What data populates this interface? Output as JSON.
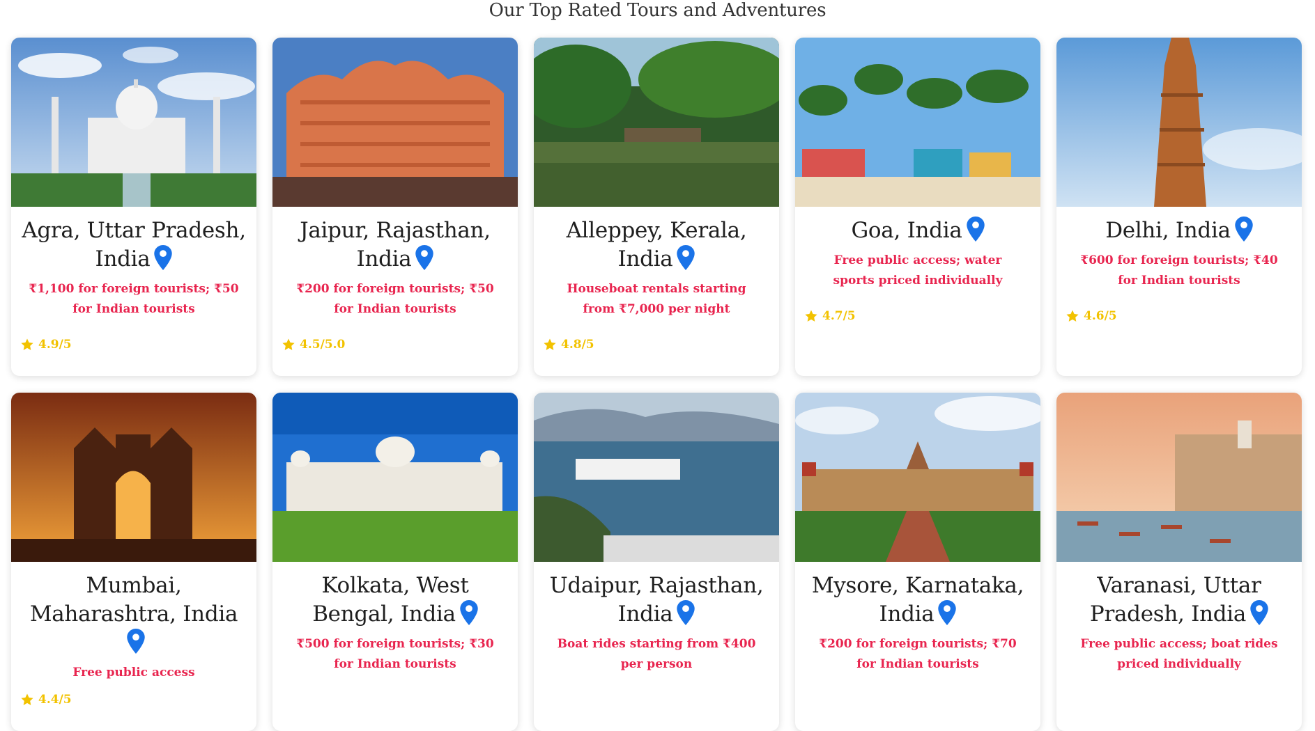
{
  "heading": "Our Top Rated Tours and Adventures",
  "icons": {
    "location": "map-pin-icon",
    "rating": "star-icon"
  },
  "colors": {
    "price": "#e8254f",
    "rating": "#f2c200",
    "pin": "#1a73e8"
  },
  "tours": [
    {
      "title": "Agra, Uttar Pradesh, India",
      "price": "₹1,100 for foreign tourists; ₹50 for Indian tourists",
      "rating": "4.9/5"
    },
    {
      "title": "Jaipur, Rajasthan, India",
      "price": "₹200 for foreign tourists; ₹50 for Indian tourists",
      "rating": "4.5/5.0"
    },
    {
      "title": "Alleppey, Kerala, India",
      "price": "Houseboat rentals starting from ₹7,000 per night",
      "rating": "4.8/5"
    },
    {
      "title": "Goa, India",
      "price": "Free public access; water sports priced individually",
      "rating": "4.7/5"
    },
    {
      "title": "Delhi, India",
      "price": "₹600 for foreign tourists; ₹40 for Indian tourists",
      "rating": "4.6/5"
    },
    {
      "title": "Mumbai, Maharashtra, India",
      "price": "Free public access",
      "rating": "4.4/5"
    },
    {
      "title": "Kolkata, West Bengal, India",
      "price": "₹500 for foreign tourists; ₹30 for Indian tourists",
      "rating": ""
    },
    {
      "title": "Udaipur, Rajasthan, India",
      "price": "Boat rides starting from ₹400 per person",
      "rating": ""
    },
    {
      "title": "Mysore, Karnataka, India",
      "price": "₹200 for foreign tourists; ₹70 for Indian tourists",
      "rating": ""
    },
    {
      "title": "Varanasi, Uttar Pradesh, India",
      "price": "Free public access; boat rides priced individually",
      "rating": ""
    }
  ]
}
